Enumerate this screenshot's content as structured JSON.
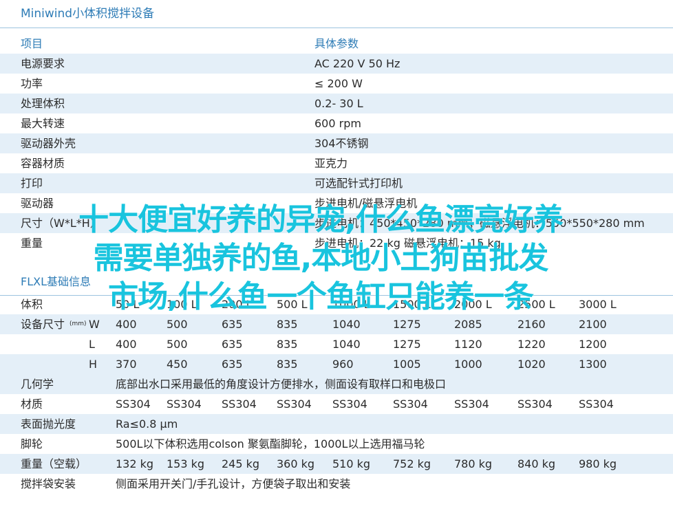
{
  "title": "Miniwind小体积搅拌设备",
  "spec_table": {
    "header": [
      "项目",
      "具体参数"
    ],
    "rows": [
      [
        "电源要求",
        "AC 220  V 50 Hz"
      ],
      [
        "功率",
        "≤ 200 W"
      ],
      [
        "处理体积",
        "0.2-  30 L"
      ],
      [
        "最大转速",
        "600  rpm"
      ],
      [
        "驱动器外壳",
        "304不锈钢"
      ],
      [
        "容器材质",
        "亚克力"
      ],
      [
        "打印",
        "可选配针式打印机"
      ],
      [
        "驱动器",
        "步进电机/磁悬浮电机"
      ],
      [
        "尺寸（W*L*H）",
        "步进电机：450*450*280 mm；磁悬浮电机：550*550*280 mm"
      ],
      [
        "重量",
        "步进电机：22 kg 磁悬浮电机：15 kg"
      ]
    ]
  },
  "section2_title": "FLXL基础信息",
  "base_table": {
    "volume": {
      "label": "体积",
      "values": [
        "50 L",
        "100 L",
        "200 L",
        "500 L",
        "1000 L",
        "1500 L",
        "2000 L",
        "2500 L",
        "3000 L"
      ]
    },
    "size_label": "设备尺寸",
    "size_unit": "(mm)",
    "size_rows": [
      {
        "dim": "W",
        "values": [
          "400",
          "500",
          "635",
          "835",
          "1040",
          "1275",
          "2085",
          "2160",
          "2100"
        ]
      },
      {
        "dim": "L",
        "values": [
          "400",
          "500",
          "635",
          "835",
          "1040",
          "1275",
          "1120",
          "1220",
          "1200"
        ]
      },
      {
        "dim": "H",
        "values": [
          "370",
          "450",
          "635",
          "835",
          "960",
          "1005",
          "1000",
          "1020",
          "1300"
        ]
      }
    ],
    "geometry": {
      "label": "几何学",
      "text": "底部出水口采用最低的角度设计方便排水，侧面设有取样口和电极口"
    },
    "material": {
      "label": "材质",
      "values": [
        "SS304",
        "SS304",
        "SS304",
        "SS304",
        "SS304",
        "SS304",
        "SS304",
        "SS304",
        "SS304"
      ]
    },
    "polish": {
      "label": "表面抛光度",
      "text": "Ra≤0.8 μm"
    },
    "casters": {
      "label": "脚轮",
      "text": "500L以下体积选用colson 聚氨酯脚轮，1000L以上选用福马轮"
    },
    "weight": {
      "label": "重量（空载）",
      "values": [
        "132 kg",
        "153 kg",
        "245 kg",
        "360 kg",
        "510 kg",
        "752 kg",
        "780 kg",
        "840 kg",
        "980 kg"
      ]
    },
    "bag": {
      "label": "搅拌袋安装",
      "text": "侧面采用开关门/手孔设计，方便袋子取出和安装"
    }
  },
  "overlay": {
    "lines": [
      "十大便宜好养的异宠,什么鱼漂亮好养",
      "需要单独养的鱼,本地小土狗苗批发",
      "市场,什么鱼一个鱼缸只能养一条"
    ],
    "color": "#19c4de"
  }
}
